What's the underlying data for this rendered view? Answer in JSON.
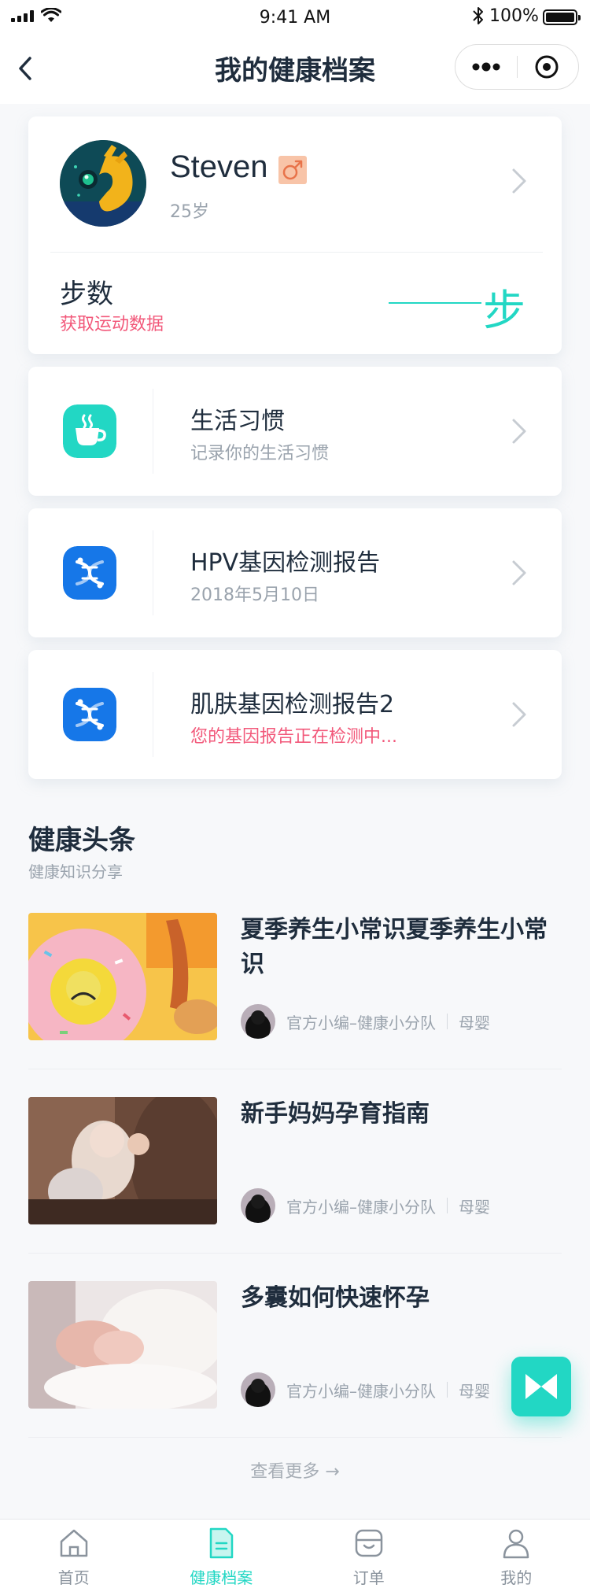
{
  "status_bar": {
    "time": "9:41 AM",
    "battery": "100%"
  },
  "nav": {
    "title": "我的健康档案"
  },
  "profile": {
    "name": "Steven",
    "gender_symbol": "♂",
    "age": "25岁",
    "steps_label": "步数",
    "steps_link": "获取运动数据",
    "steps_unit": "步"
  },
  "records": [
    {
      "icon": "coffee-cup-icon",
      "title": "生活习惯",
      "subtitle": "记录你的生活习惯",
      "icon_color": "#22d7c4"
    },
    {
      "icon": "dna-icon",
      "title": "HPV基因检测报告",
      "subtitle": "2018年5月10日",
      "icon_color": "#1677e8"
    },
    {
      "icon": "dna-icon",
      "title": "肌肤基因检测报告2",
      "subtitle": "您的基因报告正在检测中...",
      "icon_color": "#1677e8"
    }
  ],
  "news": {
    "title": "健康头条",
    "subtitle": "健康知识分享",
    "items": [
      {
        "title": "夏季养生小常识夏季养生小常识",
        "author": "官方小编–健康小分队",
        "tag": "母婴"
      },
      {
        "title": "新手妈妈孕育指南",
        "author": "官方小编–健康小分队",
        "tag": "母婴"
      },
      {
        "title": "多囊如何快速怀孕",
        "author": "官方小编–健康小分队",
        "tag": "母婴"
      }
    ],
    "see_more": "查看更多 →"
  },
  "tabs": [
    {
      "label": "首页",
      "icon": "home-icon"
    },
    {
      "label": "健康档案",
      "icon": "document-icon",
      "active": true
    },
    {
      "label": "订单",
      "icon": "order-icon"
    },
    {
      "label": "我的",
      "icon": "person-icon"
    }
  ],
  "colors": {
    "accent": "#22d7c4",
    "alert": "#f2587a",
    "blue": "#1677e8"
  }
}
